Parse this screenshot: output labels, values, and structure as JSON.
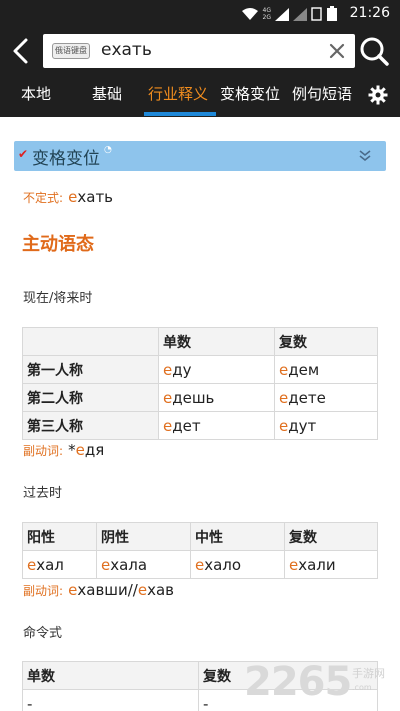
{
  "status": {
    "time": "21:26",
    "net_top": "4G",
    "net_bottom": "2G"
  },
  "search": {
    "keyboard_label": "俄语键盘",
    "query": "ехать"
  },
  "tabs": [
    "本地",
    "基础",
    "行业释义",
    "变格变位",
    "例句短语"
  ],
  "section": {
    "title": "变格变位"
  },
  "infinitive": {
    "label": "不定式:",
    "stress": "е",
    "rest": "хать"
  },
  "active_voice": "主动语态",
  "present": {
    "title": "现在/将来时",
    "headers": [
      "",
      "单数",
      "复数"
    ],
    "rows": [
      {
        "label": "第一人称",
        "sg_stress": "е",
        "sg_rest": "ду",
        "pl_stress": "е",
        "pl_rest": "дем"
      },
      {
        "label": "第二人称",
        "sg_stress": "е",
        "sg_rest": "дешь",
        "pl_stress": "е",
        "pl_rest": "дете"
      },
      {
        "label": "第三人称",
        "sg_stress": "е",
        "sg_rest": "дет",
        "pl_stress": "е",
        "pl_rest": "дут"
      }
    ],
    "adverbial_label": "副动词:",
    "adverbial_prefix": "*",
    "adverbial_stress": "е",
    "adverbial_rest": "дя"
  },
  "past": {
    "title": "过去时",
    "headers": [
      "阳性",
      "阴性",
      "中性",
      "复数"
    ],
    "forms": [
      {
        "stress": "е",
        "rest": "хал"
      },
      {
        "stress": "е",
        "rest": "хала"
      },
      {
        "stress": "е",
        "rest": "хало"
      },
      {
        "stress": "е",
        "rest": "хали"
      }
    ],
    "adverbial_label": "副动词:",
    "adverbial_stress1": "е",
    "adverbial_rest1": "хавши//",
    "adverbial_stress2": "е",
    "adverbial_rest2": "хав"
  },
  "imperative": {
    "title": "命令式",
    "headers": [
      "单数",
      "复数"
    ],
    "values": [
      "-",
      "-"
    ]
  },
  "watermark": {
    "number": "2265",
    "sub": "手游网",
    "url": ".com"
  },
  "colors": {
    "accent": "#f08c1e",
    "tab_underline": "#1e88d8",
    "section_bar": "#8ec4ec",
    "stress": "#e07020"
  }
}
